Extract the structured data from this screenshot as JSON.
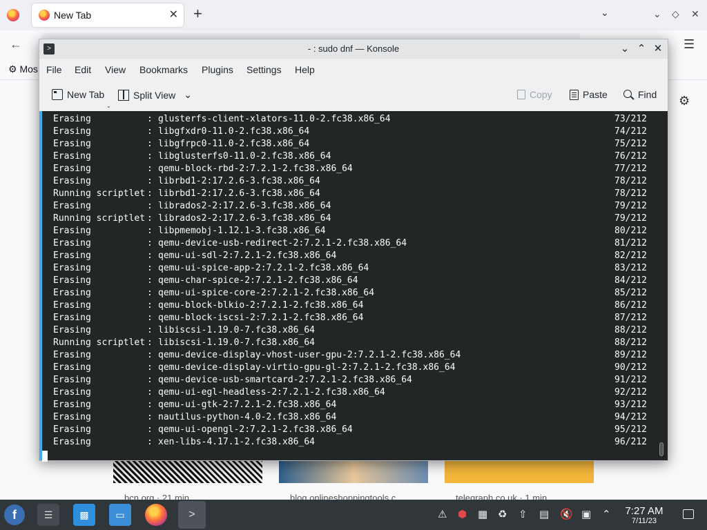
{
  "firefox": {
    "tab_title": "New Tab",
    "tab_close": "✕",
    "new_tab": "+",
    "tab_list": "⌄",
    "bookmark_label": "Mos",
    "captions": [
      "bcn.org · 21 min",
      "blog.onlineshoppingtools.c",
      "telegraph.co.uk · 1 min"
    ]
  },
  "konsole": {
    "title": "- : sudo dnf — Konsole",
    "menu": [
      "File",
      "Edit",
      "View",
      "Bookmarks",
      "Plugins",
      "Settings",
      "Help"
    ],
    "toolbar": {
      "new_tab": "New Tab",
      "split_view": "Split View",
      "copy": "Copy",
      "paste": "Paste",
      "find": "Find"
    },
    "lines": [
      {
        "action": "Erasing",
        "pkg": "glusterfs-client-xlators-11.0-2.fc38.x86_64",
        "count": "73/212"
      },
      {
        "action": "Erasing",
        "pkg": "libgfxdr0-11.0-2.fc38.x86_64",
        "count": "74/212"
      },
      {
        "action": "Erasing",
        "pkg": "libgfrpc0-11.0-2.fc38.x86_64",
        "count": "75/212"
      },
      {
        "action": "Erasing",
        "pkg": "libglusterfs0-11.0-2.fc38.x86_64",
        "count": "76/212"
      },
      {
        "action": "Erasing",
        "pkg": "qemu-block-rbd-2:7.2.1-2.fc38.x86_64",
        "count": "77/212"
      },
      {
        "action": "Erasing",
        "pkg": "librbd1-2:17.2.6-3.fc38.x86_64",
        "count": "78/212"
      },
      {
        "action": "Running scriptlet",
        "pkg": "librbd1-2:17.2.6-3.fc38.x86_64",
        "count": "78/212"
      },
      {
        "action": "Erasing",
        "pkg": "librados2-2:17.2.6-3.fc38.x86_64",
        "count": "79/212"
      },
      {
        "action": "Running scriptlet",
        "pkg": "librados2-2:17.2.6-3.fc38.x86_64",
        "count": "79/212"
      },
      {
        "action": "Erasing",
        "pkg": "libpmemobj-1.12.1-3.fc38.x86_64",
        "count": "80/212"
      },
      {
        "action": "Erasing",
        "pkg": "qemu-device-usb-redirect-2:7.2.1-2.fc38.x86_64",
        "count": "81/212"
      },
      {
        "action": "Erasing",
        "pkg": "qemu-ui-sdl-2:7.2.1-2.fc38.x86_64",
        "count": "82/212"
      },
      {
        "action": "Erasing",
        "pkg": "qemu-ui-spice-app-2:7.2.1-2.fc38.x86_64",
        "count": "83/212"
      },
      {
        "action": "Erasing",
        "pkg": "qemu-char-spice-2:7.2.1-2.fc38.x86_64",
        "count": "84/212"
      },
      {
        "action": "Erasing",
        "pkg": "qemu-ui-spice-core-2:7.2.1-2.fc38.x86_64",
        "count": "85/212"
      },
      {
        "action": "Erasing",
        "pkg": "qemu-block-blkio-2:7.2.1-2.fc38.x86_64",
        "count": "86/212"
      },
      {
        "action": "Erasing",
        "pkg": "qemu-block-iscsi-2:7.2.1-2.fc38.x86_64",
        "count": "87/212"
      },
      {
        "action": "Erasing",
        "pkg": "libiscsi-1.19.0-7.fc38.x86_64",
        "count": "88/212"
      },
      {
        "action": "Running scriptlet",
        "pkg": "libiscsi-1.19.0-7.fc38.x86_64",
        "count": "88/212"
      },
      {
        "action": "Erasing",
        "pkg": "qemu-device-display-vhost-user-gpu-2:7.2.1-2.fc38.x86_64",
        "count": "89/212"
      },
      {
        "action": "Erasing",
        "pkg": "qemu-device-display-virtio-gpu-gl-2:7.2.1-2.fc38.x86_64",
        "count": "90/212"
      },
      {
        "action": "Erasing",
        "pkg": "qemu-device-usb-smartcard-2:7.2.1-2.fc38.x86_64",
        "count": "91/212"
      },
      {
        "action": "Erasing",
        "pkg": "qemu-ui-egl-headless-2:7.2.1-2.fc38.x86_64",
        "count": "92/212"
      },
      {
        "action": "Erasing",
        "pkg": "qemu-ui-gtk-2:7.2.1-2.fc38.x86_64",
        "count": "93/212"
      },
      {
        "action": "Erasing",
        "pkg": "nautilus-python-4.0-2.fc38.x86_64",
        "count": "94/212"
      },
      {
        "action": "Erasing",
        "pkg": "qemu-ui-opengl-2:7.2.1-2.fc38.x86_64",
        "count": "95/212"
      },
      {
        "action": "Erasing",
        "pkg": "xen-libs-4.17.1-2.fc38.x86_64",
        "count": "96/212"
      }
    ]
  },
  "taskbar": {
    "time": "7:27 AM",
    "date": "7/11/23"
  },
  "colors": {
    "terminal_bg": "#232627",
    "terminal_fg": "#fcfcfc",
    "accent": "#3daee9",
    "taskbar_bg": "#31363b"
  }
}
